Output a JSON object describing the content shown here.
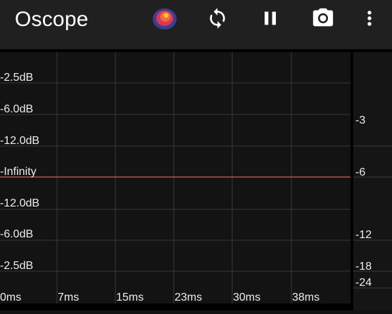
{
  "app_bar": {
    "title": "Oscope",
    "background": "#202020",
    "actions": [
      {
        "name": "spectrogram-icon",
        "label": "spectrogram"
      },
      {
        "name": "refresh-icon",
        "label": "sync"
      },
      {
        "name": "pause-icon",
        "label": "pause"
      },
      {
        "name": "camera-icon",
        "label": "screenshot"
      },
      {
        "name": "more-vert-icon",
        "label": "more"
      }
    ]
  },
  "scope": {
    "y_labels": [
      "-2.5dB",
      "-6.0dB",
      "-12.0dB",
      "-Infinity",
      "-12.0dB",
      "-6.0dB",
      "-2.5dB"
    ],
    "x_labels": [
      "0ms",
      "7ms",
      "15ms",
      "23ms",
      "30ms",
      "38ms"
    ],
    "trace_color": "#e0575f",
    "grid_color": "#3a3a3a"
  },
  "meter": {
    "labels": [
      "-3",
      "-6",
      "-12",
      "-18",
      "-24"
    ]
  }
}
